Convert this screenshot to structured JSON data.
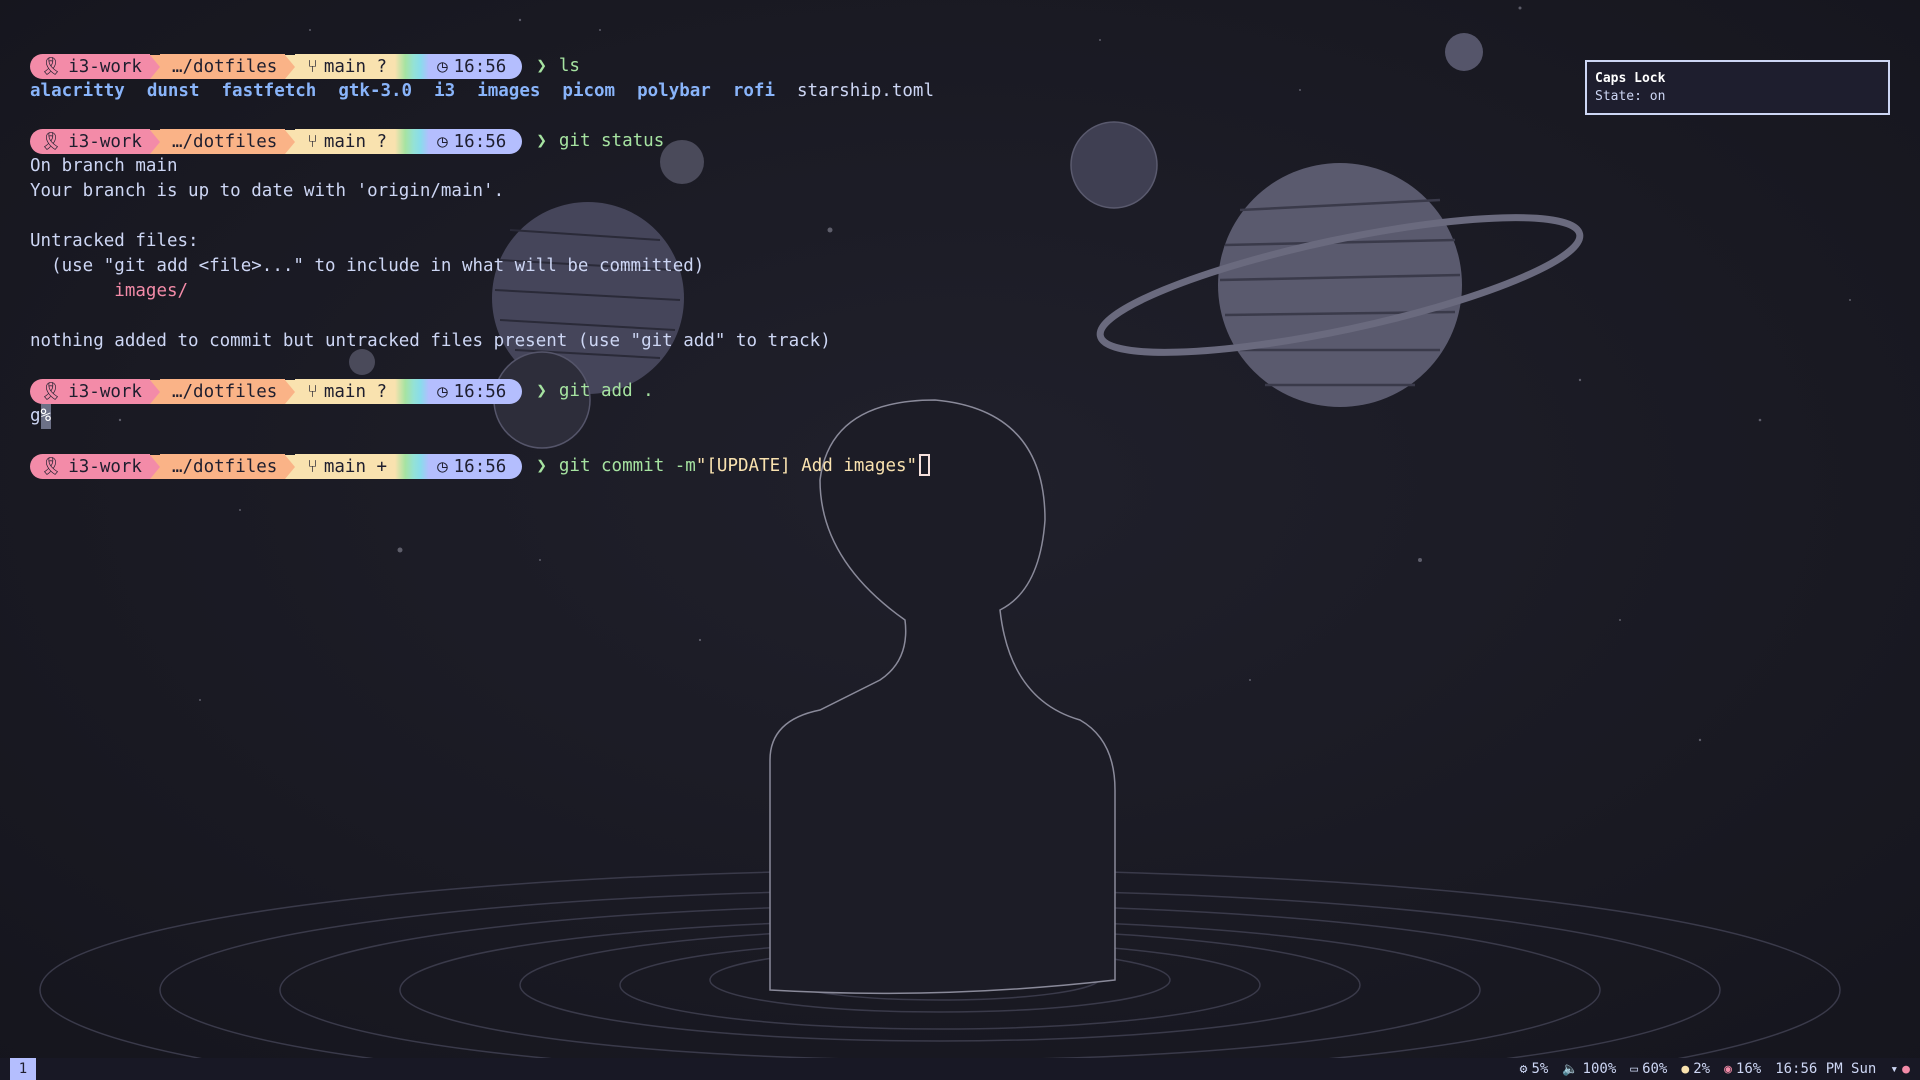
{
  "prompt": {
    "user": "i3-work",
    "dir": "…/dotfiles",
    "branch": "main",
    "status_untracked": "?",
    "status_staged": "+",
    "time": "16:56",
    "char": "❯",
    "user_icon": "ribbon-icon",
    "branch_icon": "git-branch-icon",
    "clock_icon": "clock-icon"
  },
  "blocks": [
    {
      "cmd": "ls"
    },
    {
      "cmd": "git status"
    },
    {
      "cmd": "git add ."
    },
    {
      "cmd_plain": "git commit -m",
      "cmd_string": "\"[UPDATE] Add images\""
    }
  ],
  "ls_output": {
    "dirs": [
      "alacritty",
      "dunst",
      "fastfetch",
      "gtk-3.0",
      "i3",
      "images",
      "picom",
      "polybar",
      "rofi"
    ],
    "file": "starship.toml"
  },
  "git_status": {
    "line1": "On branch main",
    "line2": "Your branch is up to date with 'origin/main'.",
    "line3": "Untracked files:",
    "line4": "  (use \"git add <file>...\" to include in what will be committed)",
    "line5": "images/",
    "line6": "nothing added to commit but untracked files present (use \"git add\" to track)"
  },
  "git_add_output": {
    "text": "g",
    "mark": "%"
  },
  "notification": {
    "title": "Caps Lock",
    "body": "State: on"
  },
  "bar": {
    "workspace": "1",
    "modules": [
      {
        "icon": "gear-icon",
        "sym": "⚙",
        "text": "5%"
      },
      {
        "icon": "volume-icon",
        "sym": "🔈",
        "text": "100%"
      },
      {
        "icon": "battery-icon",
        "sym": "▭",
        "text": "60%"
      },
      {
        "icon": "memory-icon",
        "sym": "●",
        "text": "2%"
      },
      {
        "icon": "cpu-icon",
        "sym": "◉",
        "text": "16%"
      },
      {
        "icon": "",
        "sym": "",
        "text": "16:56 PM Sun"
      }
    ]
  },
  "colors": {
    "background": "#1c1c26",
    "pink": "#f38ba8",
    "peach": "#fab387",
    "yellow": "#f9e2af",
    "lavender": "#b4befe",
    "green": "#a6e3a1",
    "blue": "#89b4fa"
  }
}
